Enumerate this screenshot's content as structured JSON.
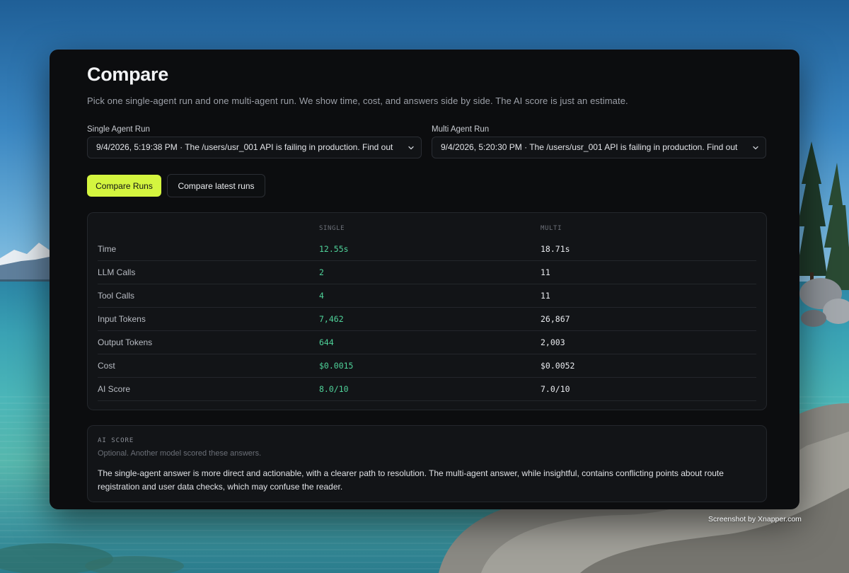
{
  "page": {
    "title": "Compare",
    "subtitle": "Pick one single-agent run and one multi-agent run. We show time, cost, and answers side by side. The AI score is just an estimate."
  },
  "single_run": {
    "label": "Single Agent Run",
    "selected": "9/4/2026, 5:19:38 PM · The /users/usr_001 API is failing in production. Find out"
  },
  "multi_run": {
    "label": "Multi Agent Run",
    "selected": "9/4/2026, 5:20:30 PM · The /users/usr_001 API is failing in production. Find out"
  },
  "actions": {
    "compare_label": "Compare Runs",
    "compare_latest_label": "Compare latest runs"
  },
  "metrics": {
    "headers": {
      "single": "SINGLE",
      "multi": "MULTI"
    },
    "rows": [
      {
        "label": "Time",
        "single": "12.55s",
        "multi": "18.71s"
      },
      {
        "label": "LLM Calls",
        "single": "2",
        "multi": "11"
      },
      {
        "label": "Tool Calls",
        "single": "4",
        "multi": "11"
      },
      {
        "label": "Input Tokens",
        "single": "7,462",
        "multi": "26,867"
      },
      {
        "label": "Output Tokens",
        "single": "644",
        "multi": "2,003"
      },
      {
        "label": "Cost",
        "single": "$0.0015",
        "multi": "$0.0052"
      },
      {
        "label": "AI Score",
        "single": "8.0/10",
        "multi": "7.0/10"
      }
    ]
  },
  "ai_score": {
    "heading": "AI SCORE",
    "note": "Optional. Another model scored these answers.",
    "text": "The single-agent answer is more direct and actionable, with a clearer path to resolution. The multi-agent answer, while insightful, contains conflicting points about route registration and user data checks, which may confuse the reader."
  },
  "watermark": "Screenshot by Xnapper.com",
  "colors": {
    "accent": "#d4f53f",
    "single_value": "#4fd39a",
    "window_bg": "#0c0d0f",
    "card_bg": "#121417"
  },
  "icons": {
    "select_chevron": "chevron-down-icon"
  }
}
